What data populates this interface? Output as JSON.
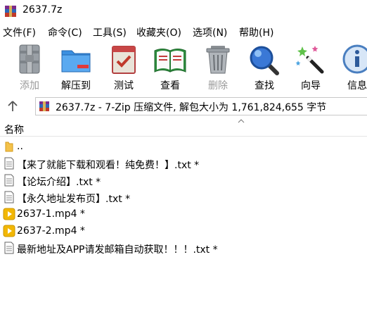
{
  "window": {
    "title": "2637.7z"
  },
  "menu": [
    "文件(F)",
    "命令(C)",
    "工具(S)",
    "收藏夹(O)",
    "选项(N)",
    "帮助(H)"
  ],
  "toolbar": [
    {
      "label": "添加",
      "icon": "add-icon",
      "enabled": false
    },
    {
      "label": "解压到",
      "icon": "extract-folder-icon",
      "enabled": true
    },
    {
      "label": "测试",
      "icon": "test-icon",
      "enabled": true
    },
    {
      "label": "查看",
      "icon": "view-book-icon",
      "enabled": true
    },
    {
      "label": "删除",
      "icon": "trash-icon",
      "enabled": false
    },
    {
      "label": "查找",
      "icon": "magnifier-icon",
      "enabled": true
    },
    {
      "label": "向导",
      "icon": "wizard-wand-icon",
      "enabled": true
    },
    {
      "label": "信息",
      "icon": "info-icon",
      "enabled": true
    }
  ],
  "address": {
    "text": "2637.7z - 7-Zip 压缩文件, 解包大小为 1,761,824,655 字节"
  },
  "columns": {
    "name": "名称"
  },
  "files": [
    {
      "name": "..",
      "type": "folder"
    },
    {
      "name": "【来了就能下载和观看！纯免费！】.txt *",
      "type": "txt"
    },
    {
      "name": "【论坛介绍】.txt *",
      "type": "txt"
    },
    {
      "name": "【永久地址发布页】.txt *",
      "type": "txt"
    },
    {
      "name": "2637-1.mp4 *",
      "type": "mp4"
    },
    {
      "name": "2637-2.mp4 *",
      "type": "mp4"
    },
    {
      "name": "最新地址及APP请发邮箱自动获取！！！.txt *",
      "type": "txt"
    }
  ],
  "colors": {
    "disabled_text": "#9a9a9a",
    "folder": "#f4c24a",
    "video": "#f2b705"
  }
}
